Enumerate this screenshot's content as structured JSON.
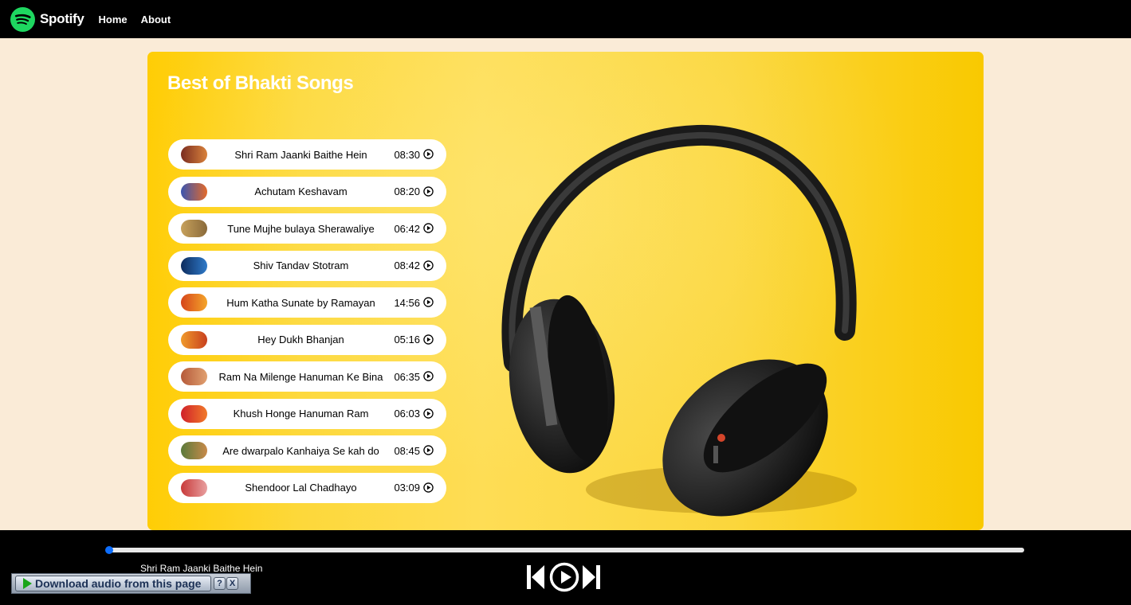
{
  "nav": {
    "brand": "Spotify",
    "links": [
      "Home",
      "About"
    ]
  },
  "playlist": {
    "title": "Best of Bhakti Songs",
    "songs": [
      {
        "name": "Shri Ram Jaanki Baithe Hein",
        "duration": "08:30",
        "thumb_colors": [
          "#7a2c20",
          "#d9823c"
        ]
      },
      {
        "name": "Achutam Keshavam",
        "duration": "08:20",
        "thumb_colors": [
          "#3a55b0",
          "#e46a2a"
        ]
      },
      {
        "name": "Tune Mujhe bulaya Sherawaliye",
        "duration": "06:42",
        "thumb_colors": [
          "#c7a15c",
          "#8a6a3a"
        ]
      },
      {
        "name": "Shiv Tandav Stotram",
        "duration": "08:42",
        "thumb_colors": [
          "#0d2c5e",
          "#2f7ac9"
        ]
      },
      {
        "name": "Hum Katha Sunate by Ramayan",
        "duration": "14:56",
        "thumb_colors": [
          "#d6451b",
          "#f4a52a"
        ]
      },
      {
        "name": "Hey Dukh Bhanjan",
        "duration": "05:16",
        "thumb_colors": [
          "#f09a2b",
          "#c8401e"
        ]
      },
      {
        "name": "Ram Na Milenge Hanuman Ke Bina",
        "duration": "06:35",
        "thumb_colors": [
          "#b55a3a",
          "#e0a070"
        ]
      },
      {
        "name": "Khush Honge Hanuman Ram",
        "duration": "06:03",
        "thumb_colors": [
          "#d0202a",
          "#f07a2a"
        ]
      },
      {
        "name": "Are dwarpalo Kanhaiya Se kah do",
        "duration": "08:45",
        "thumb_colors": [
          "#5a7a3a",
          "#c88a4a"
        ]
      },
      {
        "name": "Shendoor Lal Chadhayo",
        "duration": "03:09",
        "thumb_colors": [
          "#c83a3a",
          "#e8a0a0"
        ]
      }
    ]
  },
  "player": {
    "now_playing": "Shri Ram Jaanki Baithe Hein",
    "progress_percent": 0,
    "accent": "#0d6efd"
  },
  "download_widget": {
    "label": "Download audio from this page",
    "help": "?",
    "close": "X"
  },
  "colors": {
    "spotify_green": "#1ed760",
    "page_bg": "#faebd7",
    "nav_bg": "#000000"
  }
}
